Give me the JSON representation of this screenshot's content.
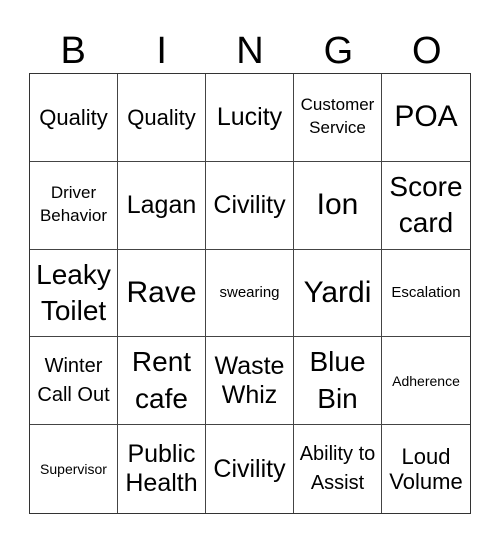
{
  "header": [
    "B",
    "I",
    "N",
    "G",
    "O"
  ],
  "cells": [
    "Quality",
    "Quality",
    "Lucity",
    "Customer Service",
    "POA",
    "Driver Behavior",
    "Lagan",
    "Civility",
    "Ion",
    "Score card",
    "Leaky Toilet",
    "Rave",
    "swearing",
    "Yardi",
    "Escalation",
    "Winter Call Out",
    "Rent cafe",
    "Waste Whiz",
    "Blue Bin",
    "Adherence",
    "Supervisor",
    "Public Health",
    "Civility",
    "Ability to Assist",
    "Loud Volume"
  ]
}
